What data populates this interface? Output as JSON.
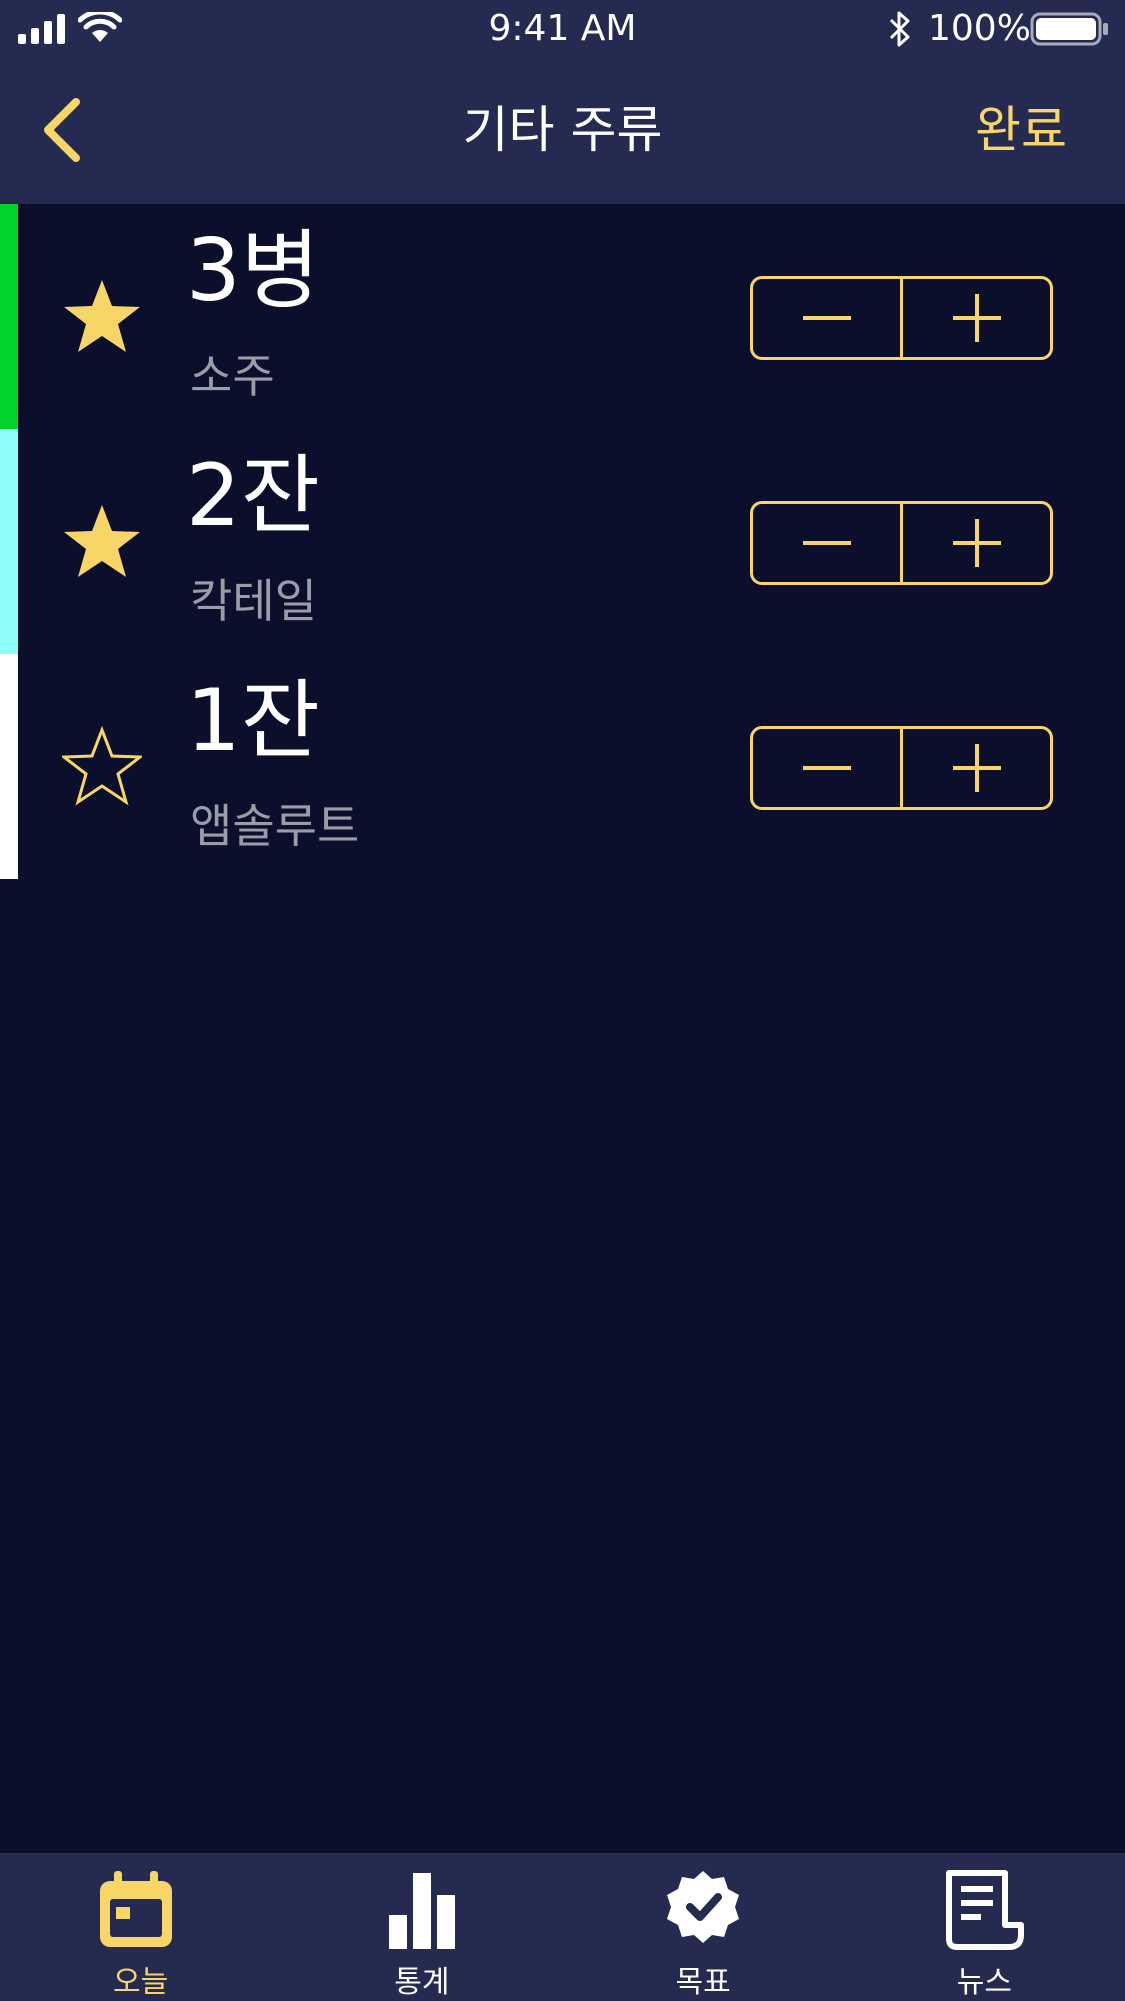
{
  "status_bar": {
    "time": "9:41 AM",
    "battery": "100%",
    "icons": [
      "signal-icon",
      "wifi-icon",
      "bluetooth-icon",
      "battery-icon"
    ]
  },
  "nav": {
    "back_icon": "chevron-left-icon",
    "title": "기타 주류",
    "done_label": "완료"
  },
  "rows": [
    {
      "amount": "3병",
      "name": "소주",
      "favorite": true,
      "color": "#00d42b"
    },
    {
      "amount": "2잔",
      "name": "칵테일",
      "favorite": true,
      "color": "#8dfdfb"
    },
    {
      "amount": "1잔",
      "name": "앱솔루트",
      "favorite": false,
      "color": "#ffffff"
    }
  ],
  "tabs": [
    {
      "label": "오늘",
      "icon": "calendar-icon",
      "active": true
    },
    {
      "label": "통계",
      "icon": "bar-chart-icon",
      "active": false
    },
    {
      "label": "목표",
      "icon": "badge-check-icon",
      "active": false
    },
    {
      "label": "뉴스",
      "icon": "newspaper-icon",
      "active": false
    }
  ],
  "colors": {
    "accent": "#f7d566",
    "background": "#0c0f2c",
    "bar_background": "#252a50",
    "secondary_text": "#9b9ca8"
  }
}
